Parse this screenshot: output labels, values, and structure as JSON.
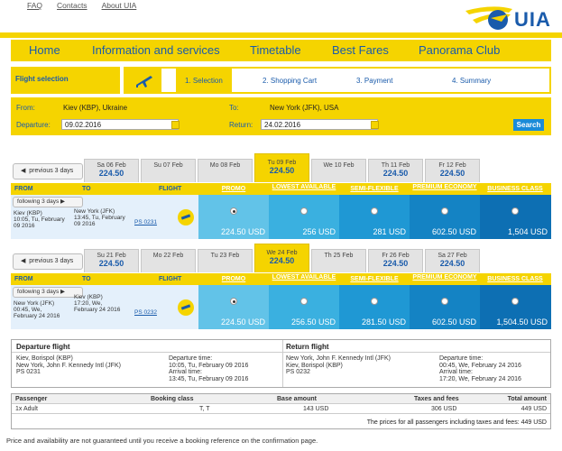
{
  "toplinks": [
    "FAQ",
    "Contacts",
    "About UIA"
  ],
  "logo": {
    "text": "UIA"
  },
  "nav": [
    "Home",
    "Information and services",
    "Timetable",
    "Best Fares",
    "Panorama Club"
  ],
  "steps": {
    "label": "Flight selection",
    "items": [
      "1. Selection",
      "2. Shopping Cart",
      "3. Payment",
      "4. Summary"
    ]
  },
  "search": {
    "from_label": "From:",
    "from_value": "Kiev (KBP), Ukraine",
    "to_label": "To:",
    "to_value": "New York (JFK), USA",
    "departure_label": "Departure:",
    "departure_value": "09.02.2016",
    "return_label": "Return:",
    "return_value": "24.02.2016",
    "button": "Search"
  },
  "header": {
    "from": "FROM",
    "to": "TO",
    "flight": "FLIGHT",
    "fares": [
      "PROMO",
      "LOWEST AVAILABLE",
      "SEMI-FLEXIBLE",
      "PREMIUM ECONOMY",
      "BUSINESS CLASS"
    ]
  },
  "outbound": {
    "prev": "previous 3 days",
    "following": "following 3 days",
    "days": [
      {
        "day": "Sa 06 Feb",
        "price": "224.50"
      },
      {
        "day": "Su 07 Feb",
        "price": ""
      },
      {
        "day": "Mo 08 Feb",
        "price": ""
      },
      {
        "day": "Tu 09 Feb",
        "price": "224.50"
      },
      {
        "day": "We 10 Feb",
        "price": ""
      },
      {
        "day": "Th 11 Feb",
        "price": "224.50"
      },
      {
        "day": "Fr 12 Feb",
        "price": "224.50"
      }
    ],
    "from_line1": "Kiev (KBP)",
    "from_line2": "10:05, Tu, February",
    "from_line3": "09 2016",
    "to_line1": "New York (JFK)",
    "to_line2": "13:45, Tu, February",
    "to_line3": "09 2016",
    "flight": "PS 0231",
    "prices": [
      "224.50 USD",
      "256 USD",
      "281 USD",
      "602.50 USD",
      "1,504 USD"
    ]
  },
  "inbound": {
    "prev": "previous 3 days",
    "following": "following 3 days",
    "days": [
      {
        "day": "Su 21 Feb",
        "price": "224.50"
      },
      {
        "day": "Mo 22 Feb",
        "price": ""
      },
      {
        "day": "Tu 23 Feb",
        "price": ""
      },
      {
        "day": "We 24 Feb",
        "price": "224.50"
      },
      {
        "day": "Th 25 Feb",
        "price": ""
      },
      {
        "day": "Fr 26 Feb",
        "price": "224.50"
      },
      {
        "day": "Sa 27 Feb",
        "price": "224.50"
      }
    ],
    "from_line1": "New York (JFK)",
    "from_line2": "00:45, We,",
    "from_line3": "February 24 2016",
    "to_line1": "Kiev (KBP)",
    "to_line2": "17:20, We,",
    "to_line3": "February 24 2016",
    "flight": "PS 0232",
    "prices": [
      "224.50 USD",
      "256.50 USD",
      "281.50 USD",
      "602.50 USD",
      "1,504.50 USD"
    ]
  },
  "summary": {
    "departure_title": "Departure flight",
    "return_title": "Return flight",
    "dep_route1": "Kiev, Borispol (KBP)",
    "dep_route2": "New York, John F. Kennedy Intl (JFK)",
    "dep_flight": "PS 0231",
    "dep_time_label": "Departure time:",
    "dep_time": "10:05, Tu, February 09 2016",
    "dep_arr_label": "Arrival time:",
    "dep_arr": "13:45, Tu, February 09 2016",
    "ret_route1": "New York, John F. Kennedy Intl (JFK)",
    "ret_route2": "Kiev, Borispol (KBP)",
    "ret_flight": "PS 0232",
    "ret_time_label": "Departure time:",
    "ret_time": "00:45, We, February 24 2016",
    "ret_arr_label": "Arrival time:",
    "ret_arr": "17:20, We, February 24 2016"
  },
  "prices_table": {
    "headers": [
      "Passenger",
      "Booking class",
      "Base amount",
      "Taxes and fees",
      "Total amount"
    ],
    "row": [
      "1x Adult",
      "T, T",
      "143 USD",
      "306 USD",
      "449 USD"
    ],
    "total_text": "The prices for all passengers including taxes and fees: 449 USD"
  },
  "disclaimer": "Price and availability are not guaranteed until you receive a booking reference on the confirmation page.",
  "colors": {
    "yellow": "#f5d400",
    "blue": "#1a5bab",
    "promo": "#62c3e8",
    "lowest": "#3ab0e0",
    "semi": "#1f98d4",
    "premium": "#1483c4",
    "business": "#0d6fb3"
  }
}
